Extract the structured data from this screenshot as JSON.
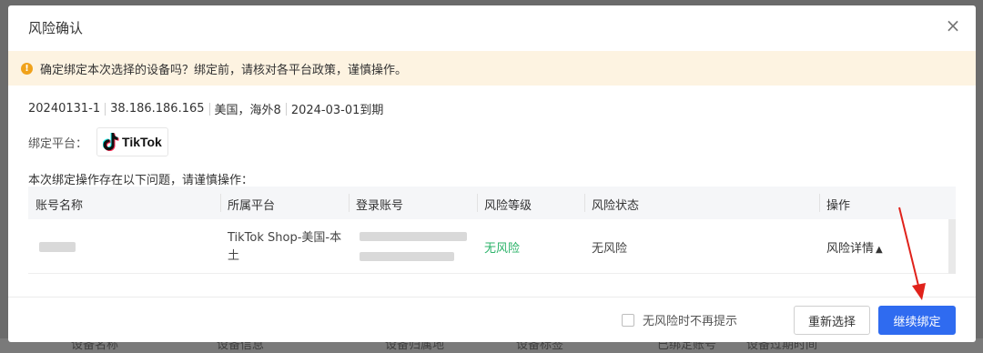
{
  "modal": {
    "title": "风险确认",
    "close_icon": "close-icon"
  },
  "alert": {
    "icon": "warning-icon",
    "text": "确定绑定本次选择的设备吗？绑定前，请核对各平台政策，谨慎操作。"
  },
  "device_info": {
    "id": "20240131-1",
    "ip": "38.186.186.165",
    "region": "美国，海外8",
    "expiry": "2024-03-01到期"
  },
  "platform": {
    "label": "绑定平台：",
    "name": "TikTok",
    "icon": "tiktok-logo-icon"
  },
  "problem_note": "本次绑定操作存在以下问题，请谨慎操作：",
  "table": {
    "headers": [
      "账号名称",
      "所属平台",
      "登录账号",
      "风险等级",
      "风险状态",
      "操作"
    ],
    "rows": [
      {
        "account_name": "",
        "platform": "TikTok Shop-美国-本土",
        "login_account": "",
        "risk_level": "无风险",
        "risk_status": "无风险",
        "action": "风险详情",
        "action_icon": "caret-up-icon"
      }
    ]
  },
  "footer": {
    "no_remind_label": "无风险时不再提示",
    "reselect_label": "重新选择",
    "continue_label": "继续绑定"
  },
  "background": {
    "columns": [
      "设备名称",
      "设备信息",
      "设备归属地",
      "设备标签",
      "已绑定账号",
      "设备过期时间"
    ]
  },
  "colors": {
    "primary": "#2f6bf0",
    "success": "#2cb36a",
    "warning": "#f0a21b",
    "alert_bg": "#fdf3e1",
    "annotation_arrow": "#e0221b"
  }
}
